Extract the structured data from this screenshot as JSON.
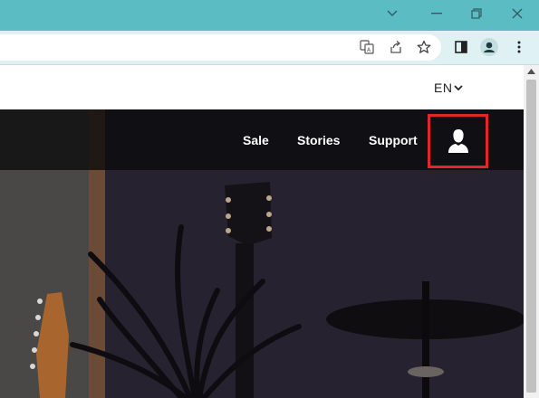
{
  "browser": {
    "window_controls": [
      "minimize",
      "restore",
      "close"
    ],
    "toolbar_icons": [
      "translate-icon",
      "share-icon",
      "bookmark-star-icon",
      "side-panel-icon",
      "profile-icon",
      "menu-icon"
    ]
  },
  "site": {
    "language": "EN",
    "nav": {
      "items": [
        {
          "label": "Sale"
        },
        {
          "label": "Stories"
        },
        {
          "label": "Support"
        }
      ]
    }
  },
  "colors": {
    "titlebar": "#5bbcc3",
    "highlight": "#e0262b"
  }
}
